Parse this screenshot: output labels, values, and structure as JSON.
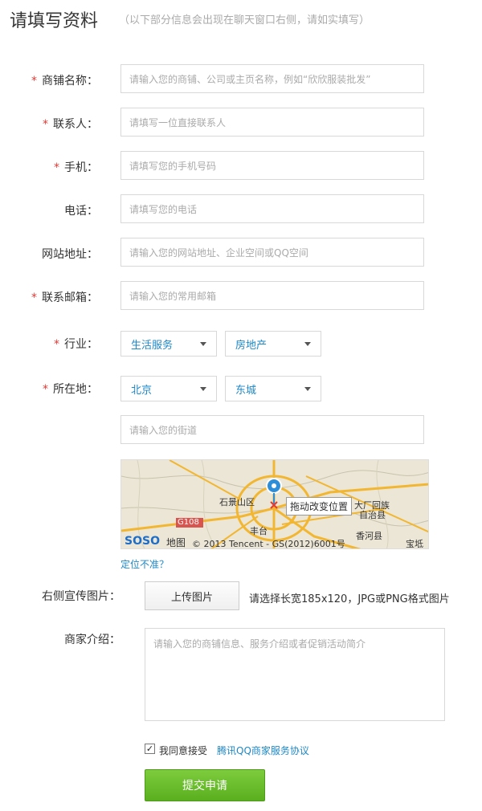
{
  "header": {
    "title": "请填写资料",
    "subtitle": "（以下部分信息会出现在聊天窗口右侧，请如实填写）"
  },
  "form": {
    "shop_name": {
      "label": "商铺名称：",
      "placeholder": "请输入您的商铺、公司或主页名称，例如“欣欣服装批发”"
    },
    "contact": {
      "label": "联系人：",
      "placeholder": "请填写一位直接联系人"
    },
    "mobile": {
      "label": "手机：",
      "placeholder": "请填写您的手机号码"
    },
    "phone": {
      "label": "电话：",
      "placeholder": "请填写您的电话"
    },
    "website": {
      "label": "网站地址：",
      "placeholder": "请输入您的网站地址、企业空间或QQ空间"
    },
    "email": {
      "label": "联系邮箱：",
      "placeholder": "请输入您的常用邮箱"
    },
    "industry": {
      "label": "行业：",
      "primary": "生活服务",
      "secondary": "房地产"
    },
    "location": {
      "label": "所在地：",
      "city": "北京",
      "district": "东城",
      "street_placeholder": "请输入您的街道"
    },
    "required_mark": "*"
  },
  "map": {
    "tip": "拖动改变位置",
    "brand": "SOSO",
    "brand_suffix": "地图",
    "copyright": "© 2013 Tencent - GS(2012)6001号",
    "labels": [
      "石景山区",
      "G108",
      "大厂回族",
      "自治县",
      "香河县",
      "宝坻",
      "丰台"
    ],
    "inaccurate_link": "定位不准？"
  },
  "promo": {
    "label": "右侧宣传图片：",
    "upload_button": "上传图片",
    "hint": "请选择长宽185x120，JPG或PNG格式图片"
  },
  "intro": {
    "label": "商家介绍：",
    "placeholder": "请输入您的商铺信息、服务介绍或者促销活动简介"
  },
  "agreement": {
    "checked": true,
    "check_glyph": "✓",
    "text": "我同意接受",
    "link": "腾讯QQ商家服务协议"
  },
  "submit_label": "提交申请",
  "colors": {
    "accent_link": "#1e88c7",
    "submit_green": "#6cbf2d",
    "required_red": "#e53935"
  }
}
